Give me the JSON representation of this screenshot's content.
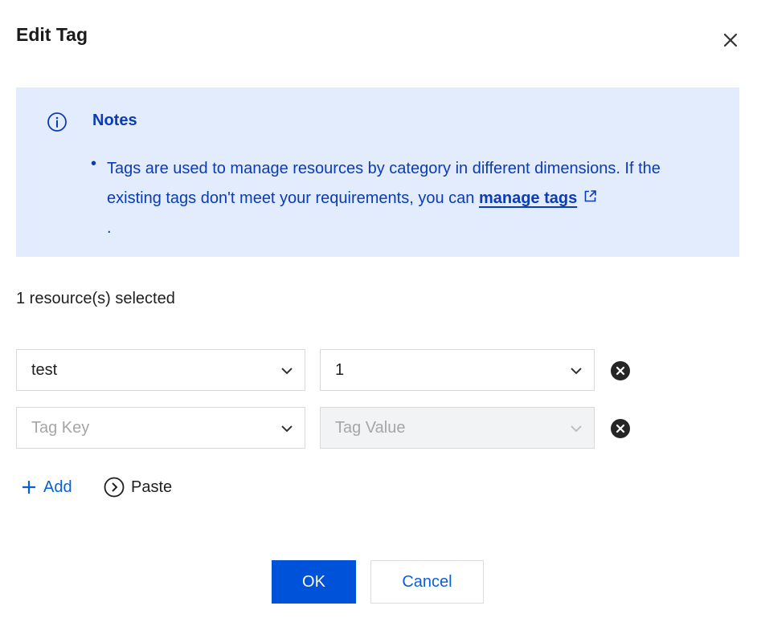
{
  "dialog": {
    "title": "Edit Tag"
  },
  "notice": {
    "title": "Notes",
    "bullet": "•",
    "text_before_link": "Tags are used to manage resources by category in different dimensions. If the existing tags don't meet your requirements, you can ",
    "link_label": "manage tags",
    "text_after_link": "."
  },
  "selection": {
    "summary": "1 resource(s) selected"
  },
  "tag_rows": [
    {
      "key": "test",
      "value": "1"
    },
    {
      "key_placeholder": "Tag Key",
      "value_placeholder": "Tag Value"
    }
  ],
  "actions": {
    "add_label": "Add",
    "paste_label": "Paste"
  },
  "footer": {
    "ok_label": "OK",
    "cancel_label": "Cancel"
  },
  "colors": {
    "primary": "#0052d9",
    "notice_bg": "#e3ecfc",
    "notice_text": "#0b3bb5",
    "link": "#0b5fd6"
  }
}
